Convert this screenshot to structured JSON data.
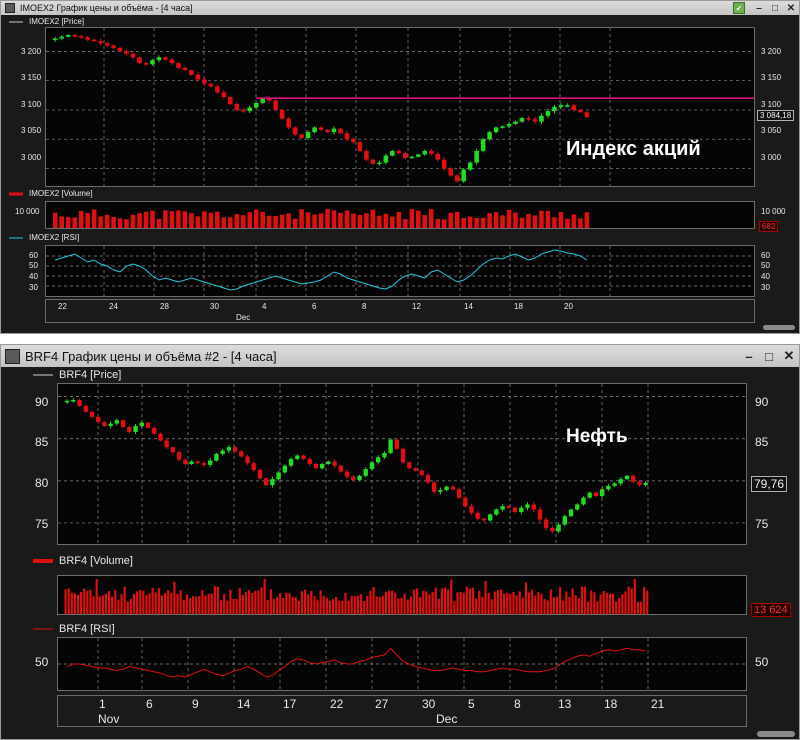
{
  "window1": {
    "title": "IMOEX2 График цены и объёма - [4 часа]",
    "price_panel_label": "IMOEX2 [Price]",
    "volume_panel_label": "IMOEX2 [Volume]",
    "rsi_panel_label": "IMOEX2 [RSI]",
    "overlay_text": "Индекс акций",
    "price_ticks_left": [
      "3 200",
      "3 150",
      "3 100",
      "3 050",
      "3 000"
    ],
    "price_ticks_right": [
      "3 200",
      "3 150",
      "3 100",
      "3 050",
      "3 000"
    ],
    "last_price_label": "3 084,18",
    "volume_tick_left": "10 000",
    "volume_tick_right": "10 000",
    "volume_last_label": "682",
    "rsi_ticks_left": [
      "60",
      "50",
      "40",
      "30"
    ],
    "rsi_ticks_right": [
      "60",
      "50",
      "40",
      "30"
    ],
    "x_ticks": [
      "22",
      "24",
      "28",
      "30",
      "4",
      "6",
      "8",
      "12",
      "14",
      "18",
      "20"
    ],
    "month_labels": [
      "Dec"
    ],
    "horizontal_line_level": 3120,
    "colors": {
      "up": "#22dd22",
      "down": "#e01010",
      "level_line": "#e0107a",
      "rsi_line": "#22c8d8",
      "volume": "#e01010"
    }
  },
  "window2": {
    "title": "BRF4 График цены и объёма #2 - [4 часа]",
    "price_panel_label": "BRF4 [Price]",
    "volume_panel_label": "BRF4 [Volume]",
    "rsi_panel_label": "BRF4 [RSI]",
    "overlay_text": "Нефть",
    "price_ticks_left": [
      "90",
      "85",
      "80",
      "75"
    ],
    "price_ticks_right": [
      "90",
      "85",
      "80",
      "75"
    ],
    "last_price_label": "79,76",
    "volume_last_label": "13 624",
    "rsi_ticks_left": [
      "50"
    ],
    "rsi_ticks_right": [
      "50"
    ],
    "x_ticks": [
      "1",
      "6",
      "9",
      "14",
      "17",
      "22",
      "27",
      "30",
      "5",
      "8",
      "13",
      "18",
      "21"
    ],
    "month_labels": [
      "Nov",
      "Dec"
    ],
    "colors": {
      "up": "#22dd22",
      "down": "#e01010",
      "rsi_line": "#e01010",
      "volume": "#e01010"
    }
  },
  "chart_data": [
    {
      "type": "candlestick",
      "title": "IMOEX2 [Price]",
      "ylim": [
        2970,
        3240
      ],
      "x_labels": [
        "22",
        "24",
        "28",
        "30",
        "4",
        "6",
        "8",
        "12",
        "14",
        "18",
        "20"
      ],
      "month_labels": [
        "Dec"
      ],
      "close_series": [
        3222,
        3225,
        3228,
        3226,
        3224,
        3220,
        3218,
        3214,
        3210,
        3206,
        3200,
        3196,
        3190,
        3180,
        3178,
        3185,
        3190,
        3186,
        3180,
        3172,
        3168,
        3160,
        3152,
        3145,
        3140,
        3130,
        3122,
        3110,
        3100,
        3098,
        3104,
        3112,
        3120,
        3116,
        3100,
        3085,
        3070,
        3058,
        3052,
        3062,
        3070,
        3066,
        3062,
        3068,
        3060,
        3050,
        3045,
        3030,
        3015,
        3008,
        3010,
        3022,
        3030,
        3026,
        3018,
        3020,
        3024,
        3030,
        3025,
        3015,
        3000,
        2988,
        2978,
        2998,
        3010,
        3030,
        3050,
        3062,
        3070,
        3072,
        3076,
        3080,
        3086,
        3084,
        3080,
        3090,
        3098,
        3105,
        3108,
        3108,
        3100,
        3096,
        3088
      ],
      "horizontal_line": 3120,
      "last_value": 3084.18
    },
    {
      "type": "bar",
      "title": "IMOEX2 [Volume]",
      "tick_label": "10 000",
      "last_value": 682
    },
    {
      "type": "line",
      "title": "IMOEX2 [RSI]",
      "ylim": [
        20,
        70
      ],
      "values": [
        56,
        58,
        60,
        62,
        58,
        54,
        56,
        52,
        50,
        46,
        44,
        50,
        52,
        50,
        46,
        40,
        36,
        38,
        36,
        34,
        36,
        38,
        36,
        34,
        32,
        30,
        28,
        26,
        27,
        30,
        32,
        34,
        36,
        38,
        40,
        38,
        36,
        34,
        32,
        33,
        34,
        36,
        40,
        44,
        42,
        38,
        36,
        34,
        32,
        30,
        28,
        27,
        30,
        36,
        40,
        42,
        40,
        38,
        44,
        46,
        42,
        38,
        34,
        36,
        40,
        46,
        52,
        56,
        58,
        57,
        60,
        62,
        59,
        56,
        58,
        62,
        64,
        66,
        65,
        63,
        62,
        60,
        56
      ]
    },
    {
      "type": "candlestick",
      "title": "BRF4 [Price]",
      "ylim": [
        72.5,
        91.5
      ],
      "x_labels": [
        "1",
        "6",
        "9",
        "14",
        "17",
        "22",
        "27",
        "30",
        "5",
        "8",
        "13",
        "18",
        "21"
      ],
      "month_labels": [
        "Nov",
        "Dec"
      ],
      "close_series": [
        89.5,
        89.6,
        88.9,
        88.2,
        87.6,
        87.0,
        86.5,
        86.8,
        87.2,
        86.4,
        85.8,
        86.5,
        86.9,
        86.3,
        85.6,
        84.8,
        84.0,
        83.4,
        82.5,
        82.0,
        82.3,
        82.1,
        81.9,
        82.4,
        83.2,
        83.6,
        84.0,
        83.5,
        82.9,
        82.1,
        81.3,
        80.3,
        79.5,
        80.2,
        81.0,
        81.8,
        82.6,
        83.0,
        82.6,
        82.0,
        81.5,
        82.0,
        82.3,
        81.8,
        81.1,
        80.5,
        80.1,
        80.6,
        81.4,
        82.2,
        82.8,
        83.3,
        84.9,
        83.8,
        82.2,
        81.5,
        81.2,
        80.7,
        79.8,
        78.7,
        78.9,
        79.3,
        79.0,
        78.0,
        77.0,
        76.2,
        75.5,
        75.3,
        76.0,
        76.6,
        77.0,
        76.8,
        76.3,
        76.8,
        77.2,
        76.6,
        75.4,
        74.4,
        74.0,
        74.8,
        75.8,
        76.6,
        77.2,
        78.0,
        78.6,
        78.2,
        79.0,
        79.4,
        79.7,
        80.2,
        80.6,
        79.9,
        79.5,
        79.76
      ],
      "last_value": 79.76
    },
    {
      "type": "bar",
      "title": "BRF4 [Volume]",
      "last_value": 13624
    },
    {
      "type": "line",
      "title": "BRF4 [RSI]",
      "ylim": [
        30,
        70
      ],
      "values": [
        48,
        50,
        50,
        49,
        48,
        47,
        47,
        46,
        45,
        46,
        48,
        47,
        46,
        45,
        44,
        43,
        41,
        40,
        41,
        40,
        42,
        44,
        46,
        44,
        42,
        41,
        43,
        45,
        46,
        48,
        46,
        43,
        40,
        41,
        45,
        48,
        52,
        54,
        53,
        51,
        50,
        51,
        52,
        53,
        51,
        50,
        50,
        52,
        53,
        55,
        56,
        57,
        62,
        57,
        52,
        50,
        48,
        47,
        46,
        45,
        45,
        46,
        47,
        46,
        45,
        45,
        44,
        44,
        45,
        46,
        47,
        46,
        46,
        45,
        44,
        44,
        44,
        45,
        46,
        49,
        52,
        54,
        56,
        57,
        56,
        58,
        60,
        61,
        60,
        61,
        62,
        61,
        61,
        60
      ]
    }
  ]
}
